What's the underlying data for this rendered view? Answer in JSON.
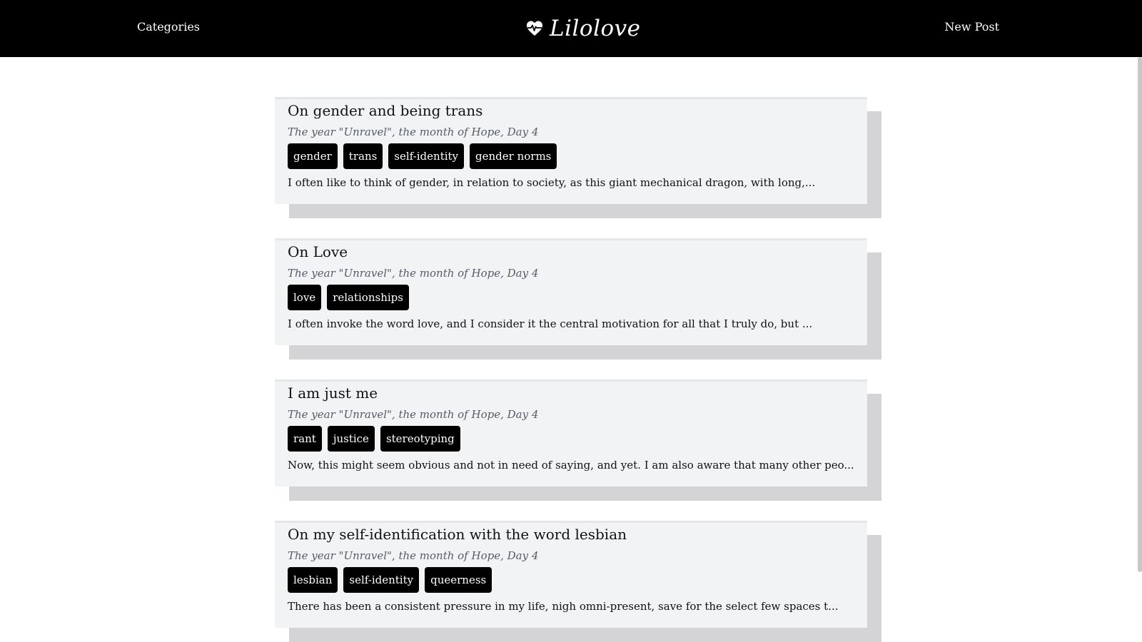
{
  "nav": {
    "left_label": "Categories",
    "brand": "Lilolove",
    "brand_icon": "heart-pulse-icon",
    "right_label": "New Post"
  },
  "posts": [
    {
      "title": "On gender and being trans",
      "date": "The year \"Unravel\", the month of Hope, Day 4",
      "tags": [
        "gender",
        "trans",
        "self-identity",
        "gender norms"
      ],
      "excerpt": "I often like to think of gender, in relation to society, as this giant mechanical dragon, with long,..."
    },
    {
      "title": "On Love",
      "date": "The year \"Unravel\", the month of Hope, Day 4",
      "tags": [
        "love",
        "relationships"
      ],
      "excerpt": "I often invoke the word love, and I consider it the central motivation for all that I truly do, but ..."
    },
    {
      "title": "I am just me",
      "date": "The year \"Unravel\", the month of Hope, Day 4",
      "tags": [
        "rant",
        "justice",
        "stereotyping"
      ],
      "excerpt": "Now, this might seem obvious and not in need of saying, and yet. I am also aware that many other peo..."
    },
    {
      "title": "On my self-identification with the word lesbian",
      "date": "The year \"Unravel\", the month of Hope, Day 4",
      "tags": [
        "lesbian",
        "self-identity",
        "queerness"
      ],
      "excerpt": "There has been a consistent pressure in my life, nigh omni-present, save for the select few spaces t..."
    }
  ],
  "colors": {
    "navbar": "#000000",
    "card": "#f2f3f5",
    "card_shadow": "#d4d4d6",
    "tag_bg": "#000000",
    "date_text": "#565b66"
  }
}
